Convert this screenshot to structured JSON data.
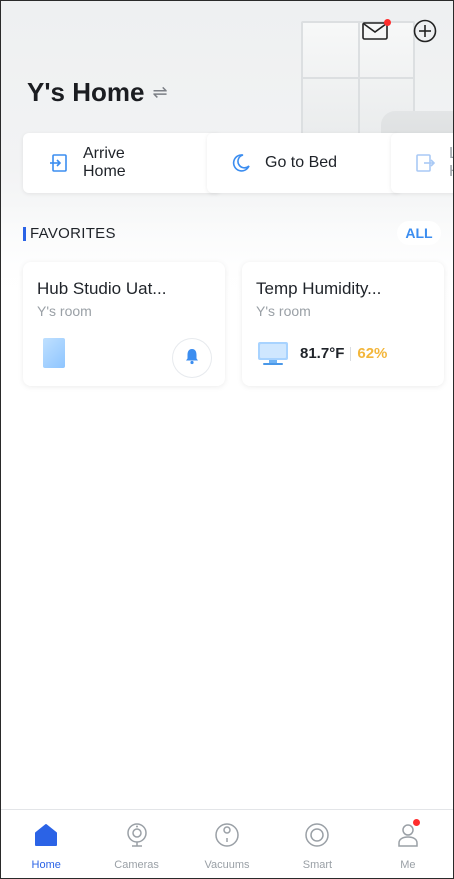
{
  "header": {
    "home_name": "Y's Home",
    "switch_symbol": "⇌"
  },
  "scenes": [
    {
      "label": "Arrive\nHome",
      "icon": "arrive-icon"
    },
    {
      "label": "Go to Bed",
      "icon": "moon-icon"
    },
    {
      "label": "L\nH",
      "icon": "leave-icon"
    }
  ],
  "favorites": {
    "title": "FAVORITES",
    "all_label": "ALL",
    "cards": [
      {
        "name": "Hub Studio Uat...",
        "room": "Y's room",
        "icon": "hub-device-icon",
        "action_icon": "bell-icon"
      },
      {
        "name": "Temp Humidity...",
        "room": "Y's room",
        "icon": "thermometer-icon",
        "temperature": "81.7°F",
        "humidity": "62%"
      }
    ]
  },
  "tabbar": {
    "tabs": [
      {
        "label": "Home",
        "icon": "home-icon",
        "active": true
      },
      {
        "label": "Cameras",
        "icon": "camera-icon",
        "active": false
      },
      {
        "label": "Vacuums",
        "icon": "vacuum-icon",
        "active": false
      },
      {
        "label": "Smart",
        "icon": "smart-icon",
        "active": false
      },
      {
        "label": "Me",
        "icon": "person-icon",
        "active": false
      }
    ]
  },
  "colors": {
    "accent": "#2b63e6",
    "link": "#3b8df0",
    "humidity": "#f3b63b",
    "notification": "#ff2d2d"
  }
}
